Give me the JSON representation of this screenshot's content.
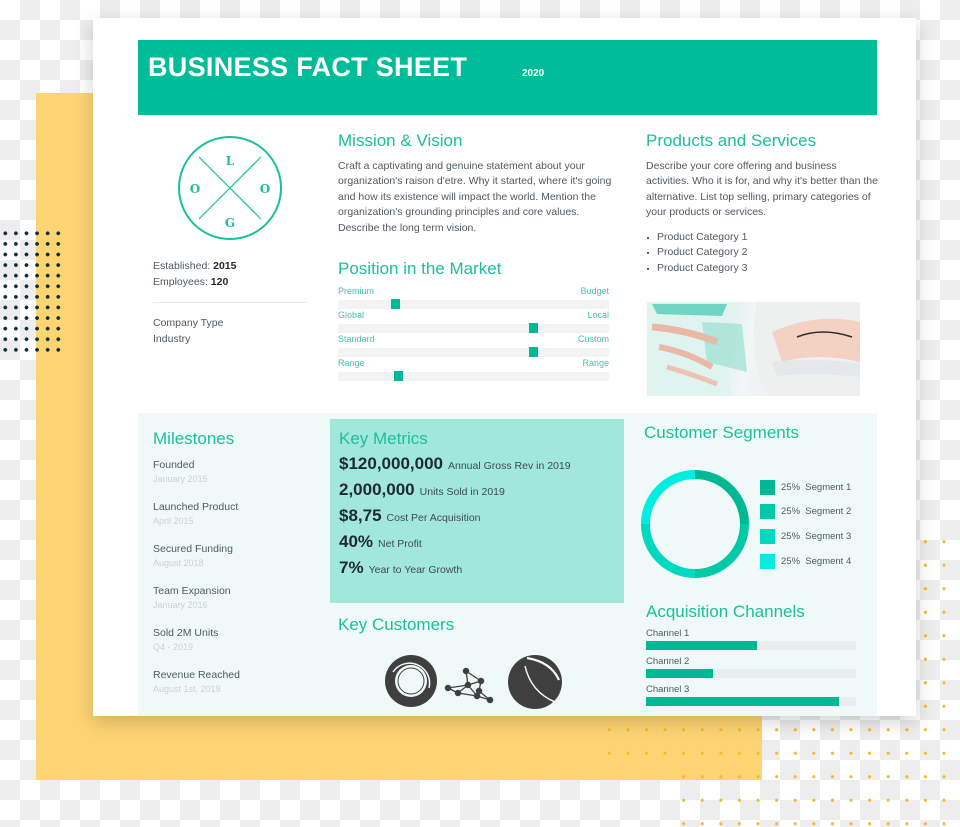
{
  "header": {
    "title": "BUSINESS FACT SHEET",
    "year": "2020"
  },
  "logo": {
    "letters": [
      "L",
      "O",
      "O",
      "G"
    ]
  },
  "company": {
    "established_label": "Established:",
    "established_value": "2015",
    "employees_label": "Employees:",
    "employees_value": "120",
    "type_label": "Company Type",
    "industry_label": "Industry"
  },
  "mission": {
    "title": "Mission & Vision",
    "text": "Craft a captivating and genuine statement about your organization's raison d'etre. Why it started, where it's going and how its existence will impact the world. Mention the organization's grounding principles and core values. Describe the long term vision."
  },
  "market": {
    "title": "Position in the Market",
    "sliders": [
      {
        "left": "Premium",
        "right": "Budget",
        "value": 0.21
      },
      {
        "left": "Global",
        "right": "Local",
        "value": 0.72
      },
      {
        "left": "Standard",
        "right": "Custom",
        "value": 0.72
      },
      {
        "left": "Range",
        "right": "Range",
        "value": 0.22
      }
    ]
  },
  "products": {
    "title": "Products and Services",
    "text": "Describe your core offering and business activities. Who it is for, and why it's better than the alternative. List top selling, primary categories of your products or services.",
    "items": [
      "Product Category 1",
      "Product Category 2",
      "Product Category 3"
    ],
    "image_alt": "architecture-photo"
  },
  "milestones": {
    "title": "Milestones",
    "items": [
      {
        "name": "Founded",
        "date": "January 2015"
      },
      {
        "name": "Launched Product",
        "date": "April 2015"
      },
      {
        "name": "Secured Funding",
        "date": "August 2018"
      },
      {
        "name": "Team Expansion",
        "date": "January 2016"
      },
      {
        "name": "Sold 2M Units",
        "date": "Q4 - 2019"
      },
      {
        "name": "Revenue Reached",
        "date": "August 1st, 2019"
      }
    ]
  },
  "metrics": {
    "title": "Key Metrics",
    "items": [
      {
        "value": "$120,000,000",
        "desc": "Annual Gross Rev in 2019"
      },
      {
        "value": "2,000,000",
        "desc": "Units Sold in 2019"
      },
      {
        "value": "$8,75",
        "desc": "Cost Per Acquisition"
      },
      {
        "value": "40%",
        "desc": "Net Profit"
      },
      {
        "value": "7%",
        "desc": "Year to Year Growth"
      }
    ]
  },
  "customers": {
    "title": "Key Customers",
    "logos": [
      "ring-logo",
      "network-logo",
      "sphere-logo"
    ]
  },
  "chart_data": [
    {
      "type": "pie",
      "title": "Customer Segments",
      "donut": true,
      "categories": [
        "Segment 1",
        "Segment 2",
        "Segment 3",
        "Segment 4"
      ],
      "values": [
        25,
        25,
        25,
        25
      ],
      "labels": [
        "25%  Segment 1",
        "25%  Segment 2",
        "25%  Segment 3",
        "25%  Segment 4"
      ],
      "colors": [
        "#00b894",
        "#00c9a7",
        "#00d9c0",
        "#00eddf"
      ],
      "legend": "right"
    },
    {
      "type": "bar",
      "orientation": "horizontal",
      "title": "Acquisition Channels",
      "categories": [
        "Channel 1",
        "Channel 2",
        "Channel 3"
      ],
      "values": [
        53,
        32,
        92
      ],
      "unit": "percent",
      "color": "#00b894"
    }
  ],
  "colors": {
    "accent": "#00bc98",
    "metrics_bg": "#a1e7db",
    "band_bg": "#effaf8",
    "yellow": "#fdd472"
  }
}
